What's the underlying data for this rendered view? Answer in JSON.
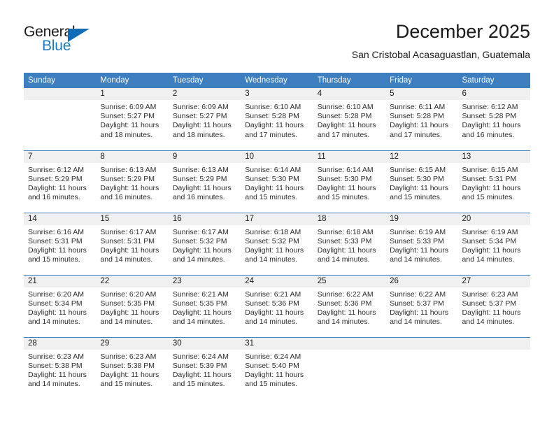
{
  "brand": {
    "name_part1": "General",
    "name_part2": "Blue"
  },
  "header": {
    "title": "December 2025",
    "subtitle": "San Cristobal Acasaguastlan, Guatemala"
  },
  "colors": {
    "header_blue": "#3c7ebf",
    "daynum_band": "#f0f0f0",
    "brand_blue": "#1d7ac4",
    "text": "#1a1a1a"
  },
  "weekdays": [
    "Sunday",
    "Monday",
    "Tuesday",
    "Wednesday",
    "Thursday",
    "Friday",
    "Saturday"
  ],
  "labels": {
    "sunrise_prefix": "Sunrise:",
    "sunset_prefix": "Sunset:",
    "daylight_prefix": "Daylight:"
  },
  "weeks": [
    [
      {
        "day": "",
        "blank": true,
        "line1": "",
        "line2": "",
        "line3": ""
      },
      {
        "day": "1",
        "blank": false,
        "line1": "Sunrise: 6:09 AM",
        "line2": "Sunset: 5:27 PM",
        "line3": "Daylight: 11 hours and 18 minutes."
      },
      {
        "day": "2",
        "blank": false,
        "line1": "Sunrise: 6:09 AM",
        "line2": "Sunset: 5:27 PM",
        "line3": "Daylight: 11 hours and 18 minutes."
      },
      {
        "day": "3",
        "blank": false,
        "line1": "Sunrise: 6:10 AM",
        "line2": "Sunset: 5:28 PM",
        "line3": "Daylight: 11 hours and 17 minutes."
      },
      {
        "day": "4",
        "blank": false,
        "line1": "Sunrise: 6:10 AM",
        "line2": "Sunset: 5:28 PM",
        "line3": "Daylight: 11 hours and 17 minutes."
      },
      {
        "day": "5",
        "blank": false,
        "line1": "Sunrise: 6:11 AM",
        "line2": "Sunset: 5:28 PM",
        "line3": "Daylight: 11 hours and 17 minutes."
      },
      {
        "day": "6",
        "blank": false,
        "line1": "Sunrise: 6:12 AM",
        "line2": "Sunset: 5:28 PM",
        "line3": "Daylight: 11 hours and 16 minutes."
      }
    ],
    [
      {
        "day": "7",
        "blank": false,
        "line1": "Sunrise: 6:12 AM",
        "line2": "Sunset: 5:29 PM",
        "line3": "Daylight: 11 hours and 16 minutes."
      },
      {
        "day": "8",
        "blank": false,
        "line1": "Sunrise: 6:13 AM",
        "line2": "Sunset: 5:29 PM",
        "line3": "Daylight: 11 hours and 16 minutes."
      },
      {
        "day": "9",
        "blank": false,
        "line1": "Sunrise: 6:13 AM",
        "line2": "Sunset: 5:29 PM",
        "line3": "Daylight: 11 hours and 16 minutes."
      },
      {
        "day": "10",
        "blank": false,
        "line1": "Sunrise: 6:14 AM",
        "line2": "Sunset: 5:30 PM",
        "line3": "Daylight: 11 hours and 15 minutes."
      },
      {
        "day": "11",
        "blank": false,
        "line1": "Sunrise: 6:14 AM",
        "line2": "Sunset: 5:30 PM",
        "line3": "Daylight: 11 hours and 15 minutes."
      },
      {
        "day": "12",
        "blank": false,
        "line1": "Sunrise: 6:15 AM",
        "line2": "Sunset: 5:30 PM",
        "line3": "Daylight: 11 hours and 15 minutes."
      },
      {
        "day": "13",
        "blank": false,
        "line1": "Sunrise: 6:15 AM",
        "line2": "Sunset: 5:31 PM",
        "line3": "Daylight: 11 hours and 15 minutes."
      }
    ],
    [
      {
        "day": "14",
        "blank": false,
        "line1": "Sunrise: 6:16 AM",
        "line2": "Sunset: 5:31 PM",
        "line3": "Daylight: 11 hours and 15 minutes."
      },
      {
        "day": "15",
        "blank": false,
        "line1": "Sunrise: 6:17 AM",
        "line2": "Sunset: 5:31 PM",
        "line3": "Daylight: 11 hours and 14 minutes."
      },
      {
        "day": "16",
        "blank": false,
        "line1": "Sunrise: 6:17 AM",
        "line2": "Sunset: 5:32 PM",
        "line3": "Daylight: 11 hours and 14 minutes."
      },
      {
        "day": "17",
        "blank": false,
        "line1": "Sunrise: 6:18 AM",
        "line2": "Sunset: 5:32 PM",
        "line3": "Daylight: 11 hours and 14 minutes."
      },
      {
        "day": "18",
        "blank": false,
        "line1": "Sunrise: 6:18 AM",
        "line2": "Sunset: 5:33 PM",
        "line3": "Daylight: 11 hours and 14 minutes."
      },
      {
        "day": "19",
        "blank": false,
        "line1": "Sunrise: 6:19 AM",
        "line2": "Sunset: 5:33 PM",
        "line3": "Daylight: 11 hours and 14 minutes."
      },
      {
        "day": "20",
        "blank": false,
        "line1": "Sunrise: 6:19 AM",
        "line2": "Sunset: 5:34 PM",
        "line3": "Daylight: 11 hours and 14 minutes."
      }
    ],
    [
      {
        "day": "21",
        "blank": false,
        "line1": "Sunrise: 6:20 AM",
        "line2": "Sunset: 5:34 PM",
        "line3": "Daylight: 11 hours and 14 minutes."
      },
      {
        "day": "22",
        "blank": false,
        "line1": "Sunrise: 6:20 AM",
        "line2": "Sunset: 5:35 PM",
        "line3": "Daylight: 11 hours and 14 minutes."
      },
      {
        "day": "23",
        "blank": false,
        "line1": "Sunrise: 6:21 AM",
        "line2": "Sunset: 5:35 PM",
        "line3": "Daylight: 11 hours and 14 minutes."
      },
      {
        "day": "24",
        "blank": false,
        "line1": "Sunrise: 6:21 AM",
        "line2": "Sunset: 5:36 PM",
        "line3": "Daylight: 11 hours and 14 minutes."
      },
      {
        "day": "25",
        "blank": false,
        "line1": "Sunrise: 6:22 AM",
        "line2": "Sunset: 5:36 PM",
        "line3": "Daylight: 11 hours and 14 minutes."
      },
      {
        "day": "26",
        "blank": false,
        "line1": "Sunrise: 6:22 AM",
        "line2": "Sunset: 5:37 PM",
        "line3": "Daylight: 11 hours and 14 minutes."
      },
      {
        "day": "27",
        "blank": false,
        "line1": "Sunrise: 6:23 AM",
        "line2": "Sunset: 5:37 PM",
        "line3": "Daylight: 11 hours and 14 minutes."
      }
    ],
    [
      {
        "day": "28",
        "blank": false,
        "line1": "Sunrise: 6:23 AM",
        "line2": "Sunset: 5:38 PM",
        "line3": "Daylight: 11 hours and 14 minutes."
      },
      {
        "day": "29",
        "blank": false,
        "line1": "Sunrise: 6:23 AM",
        "line2": "Sunset: 5:38 PM",
        "line3": "Daylight: 11 hours and 15 minutes."
      },
      {
        "day": "30",
        "blank": false,
        "line1": "Sunrise: 6:24 AM",
        "line2": "Sunset: 5:39 PM",
        "line3": "Daylight: 11 hours and 15 minutes."
      },
      {
        "day": "31",
        "blank": false,
        "line1": "Sunrise: 6:24 AM",
        "line2": "Sunset: 5:40 PM",
        "line3": "Daylight: 11 hours and 15 minutes."
      },
      {
        "day": "",
        "blank": true,
        "line1": "",
        "line2": "",
        "line3": ""
      },
      {
        "day": "",
        "blank": true,
        "line1": "",
        "line2": "",
        "line3": ""
      },
      {
        "day": "",
        "blank": true,
        "line1": "",
        "line2": "",
        "line3": ""
      }
    ]
  ]
}
